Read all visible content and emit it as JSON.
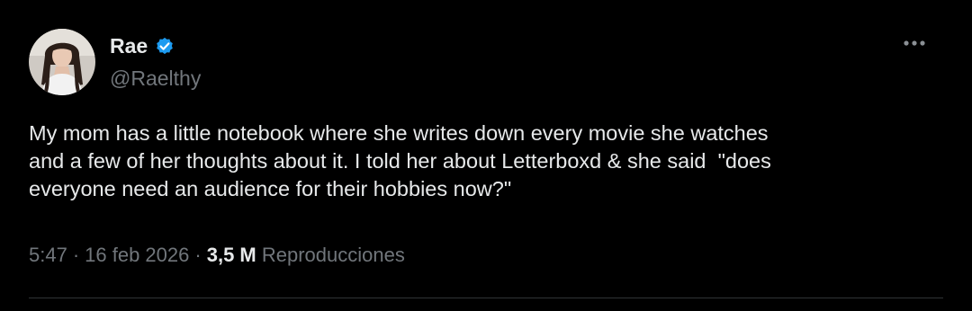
{
  "tweet": {
    "author": {
      "display_name": "Rae",
      "handle": "@Raelthy",
      "verified": true,
      "verified_color": "#1d9bf0",
      "avatar_icon": "profile-photo"
    },
    "more_icon": "ellipsis-icon",
    "text": "My mom has a little notebook where she writes down every movie she watches\nand a few of her thoughts about it. I told her about Letterboxd & she said  \"does\neveryone need an audience for their hobbies now?\"",
    "meta": {
      "time": "5:47",
      "separator": "·",
      "date": "16 feb 2026",
      "views_count": "3,5 M",
      "views_label": "Reproducciones"
    }
  },
  "colors": {
    "background": "#000000",
    "primary_text": "#e7e9ea",
    "secondary_text": "#71767b",
    "divider": "#2f3336"
  }
}
